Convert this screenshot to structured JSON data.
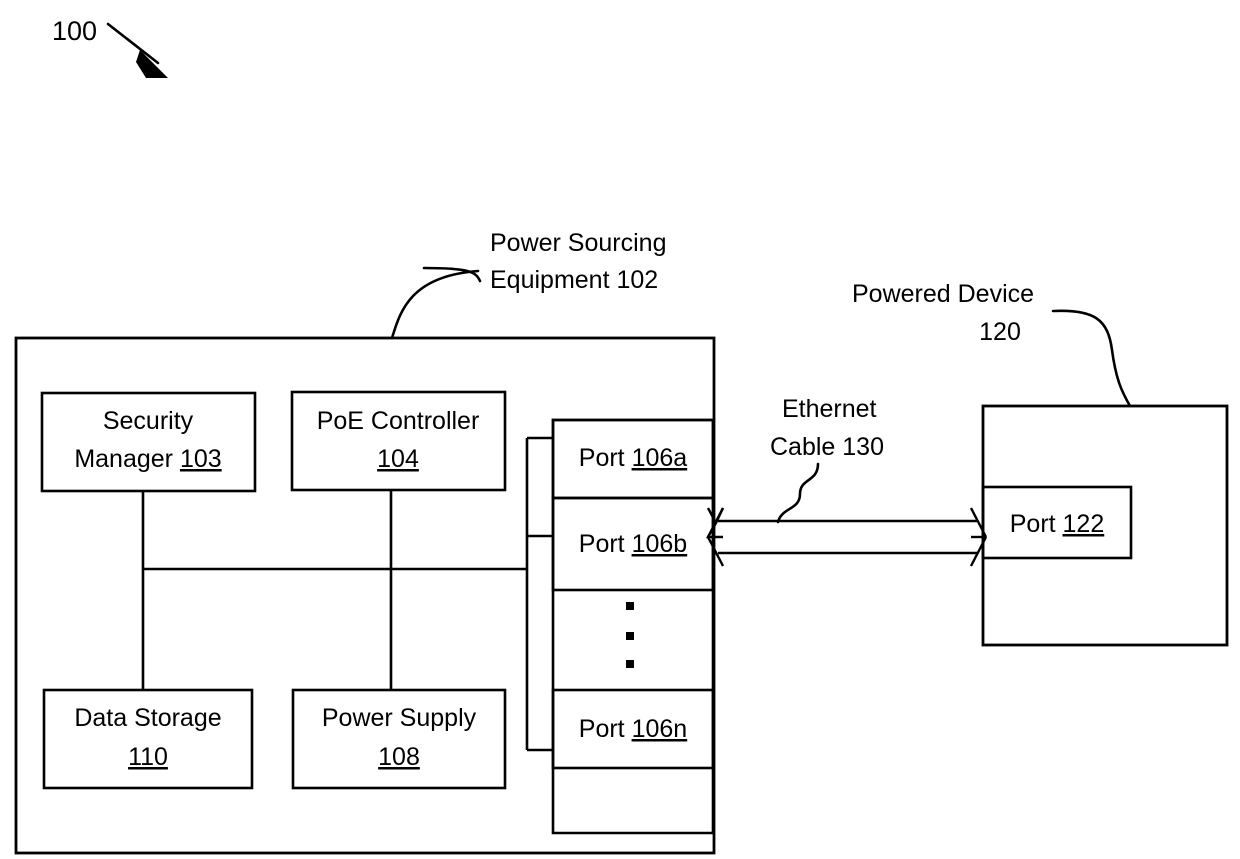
{
  "figure": {
    "number": "100"
  },
  "callouts": {
    "pse": {
      "line1": "Power Sourcing",
      "line2_text": "Equipment ",
      "line2_ref": "102"
    },
    "powered_device": {
      "line1": "Powered Device",
      "line2_ref": "120"
    },
    "ethernet_cable": {
      "line1": "Ethernet",
      "line2_text": "Cable ",
      "line2_ref": "130"
    }
  },
  "pse_components": [
    {
      "name": "security-manager",
      "line1": "Security",
      "line2_text": "Manager ",
      "ref": "103"
    },
    {
      "name": "poe-controller",
      "line1": "PoE Controller",
      "line2_text": "",
      "ref": "104"
    },
    {
      "name": "data-storage",
      "line1": "Data Storage",
      "line2_text": "",
      "ref": "110"
    },
    {
      "name": "power-supply",
      "line1": "Power Supply",
      "line2_text": "",
      "ref": "108"
    }
  ],
  "ports": {
    "pse_ports": [
      {
        "label_text": "Port ",
        "ref": "106a"
      },
      {
        "label_text": "Port ",
        "ref": "106b"
      },
      {
        "label_text": "Port ",
        "ref": "106n"
      }
    ],
    "ellipsis": "⋮",
    "pd_port": {
      "label_text": "Port ",
      "ref": "122"
    }
  },
  "colors": {
    "line": "#000000",
    "background": "#ffffff",
    "text": "#000000"
  }
}
